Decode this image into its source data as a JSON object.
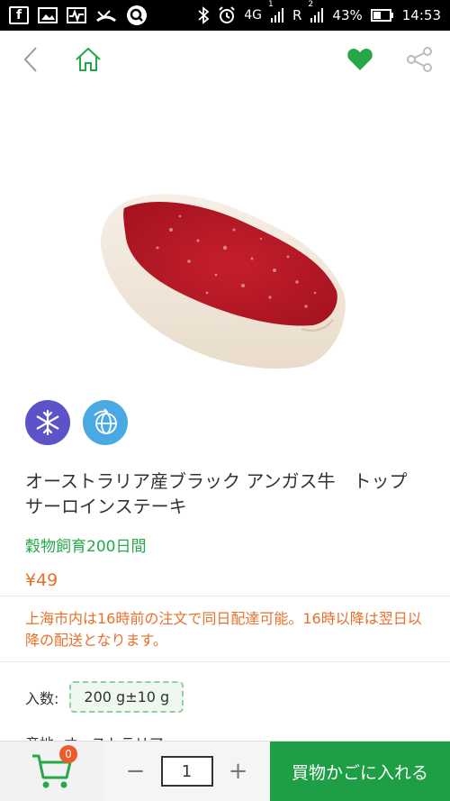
{
  "status_bar": {
    "network": "4G",
    "sim_slot_1": "1",
    "sim_slot_2": "2",
    "roaming": "R",
    "battery": "43%",
    "time": "14:53"
  },
  "product": {
    "title": "オーストラリア産ブラック アンガス牛　トップサーロインステーキ",
    "subtitle": "穀物飼育200日間",
    "price": "¥49",
    "notice": "上海市内は16時前の注文で同日配達可能。16時以降は翌日以降の配送となります。",
    "quantity_label": "入数:",
    "quantity_option": "200 g±10 g",
    "origin_partial": "産地: オーストラリア"
  },
  "bottom_bar": {
    "cart_count": "0",
    "quantity": "1",
    "minus": "−",
    "plus": "+",
    "add_to_cart": "買物かごに入れる"
  },
  "colors": {
    "accent_green": "#1e9f45",
    "heart_green": "#26a849",
    "price_orange": "#e8702a",
    "badge_purple": "#5b53c7",
    "badge_blue": "#4aa8e2"
  }
}
